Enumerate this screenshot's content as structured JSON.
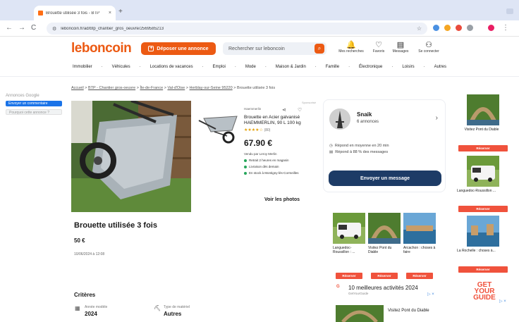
{
  "browser": {
    "tab_title": "Brouette utilisée 3 fois - BTP",
    "tab_close": "×",
    "new_tab": "+",
    "url": "leboncoin.fr/ad/btp_chantier_gros_oeuvre/2569585213",
    "nav_back": "←",
    "nav_forward": "→",
    "nav_reload": "C"
  },
  "header": {
    "logo": "leboncoin",
    "deposit_label": "Déposer une annonce",
    "search_placeholder": "Rechercher sur leboncoin",
    "icons": [
      {
        "label": "Mes recherches",
        "icon": "bell-icon",
        "glyph": "🔔"
      },
      {
        "label": "Favoris",
        "icon": "heart-icon",
        "glyph": "♡"
      },
      {
        "label": "Messages",
        "icon": "message-icon",
        "glyph": "▤"
      },
      {
        "label": "Se connecter",
        "icon": "user-icon",
        "glyph": "⚇"
      }
    ]
  },
  "categories": [
    "Immobilier",
    "·",
    "Véhicules",
    "·",
    "Locations de vacances",
    "·",
    "Emploi",
    "·",
    "Mode",
    "·",
    "Maison & Jardin",
    "·",
    "Famille",
    "·",
    "Électronique",
    "·",
    "Loisirs",
    "·",
    "Autres"
  ],
  "breadcrumb": {
    "items": [
      "Accueil",
      "BTP - Chantier gros-oeuvre",
      "Île-de-France",
      "Val-d'Oise",
      "Herblay-sur-Seine 95220",
      "Brouette utilisée 3 fois"
    ],
    "sep": ">"
  },
  "left_ad": {
    "label": "Annonces Google",
    "btn1": "Envoyer un commentaire",
    "btn2": "Pourquoi cette annonce ?"
  },
  "product": {
    "brand": "Haemmerlin",
    "promo_tag": "Sponsorisé",
    "name": "Brouette en Acier galvanisé HAEMMERLIN, 90 L 100 kg",
    "stars": "★★★★☆",
    "reviews": "(80)",
    "price": "67.90 €",
    "seller": "Vendu par Leroy Merlin",
    "features": [
      "Retrait 2 heures en magasin",
      "Livraison dès demain",
      "En stock à Montigny-lès-Cormeilles"
    ],
    "share_glyph": "⋖",
    "heart_glyph": "♡",
    "see_photos": "Voir les photos"
  },
  "listing": {
    "title": "Brouette utilisée 3 fois",
    "price": "50 €",
    "date": "10/06/2024 à 12:08",
    "criteria_title": "Critères",
    "criteria": [
      {
        "key": "Année modèle",
        "value": "2024",
        "icon": "calendar-icon",
        "glyph": "▦"
      },
      {
        "key": "Type de matériel",
        "value": "Autres",
        "icon": "tools-icon",
        "glyph": "⛏"
      }
    ]
  },
  "seller_card": {
    "name": "Snaik",
    "count": "6 annonces",
    "info": [
      {
        "icon": "clock-icon",
        "glyph": "◷",
        "text": "Répond en moyenne en 20 min"
      },
      {
        "icon": "message-icon",
        "glyph": "▤",
        "text": "Répond à 88 % des messages"
      }
    ],
    "button": "Envoyer un message"
  },
  "center_ads": [
    {
      "title": "Languedoc-Roussillon : ...",
      "reserve": "Réserver"
    },
    {
      "title": "Visitez Pont du Diable",
      "reserve": "Réserver"
    },
    {
      "title": "Arcachon : choses à faire",
      "reserve": "Réserver"
    }
  ],
  "center_ad_bottom": {
    "title": "10 meilleures activités 2024",
    "subtitle": "GetYourGuide",
    "last_title": "Visitez Pont du Diable"
  },
  "right_ads": [
    {
      "title": "Visitez Pont du Diable",
      "reserve": "Réserver"
    },
    {
      "title": "Languedoc-Roussillon ...",
      "reserve": "Réserver"
    },
    {
      "title": "La Rochelle : choses à...",
      "reserve": "Réserver"
    }
  ],
  "gyg_logo": [
    "GET",
    "YOUR",
    "GUIDE"
  ],
  "ad_choice": "▷ ×",
  "colors": {
    "brand": "#ec5a13",
    "button_dark": "#1d3b66",
    "reserve": "#f0523c",
    "stars": "#e3a008"
  }
}
